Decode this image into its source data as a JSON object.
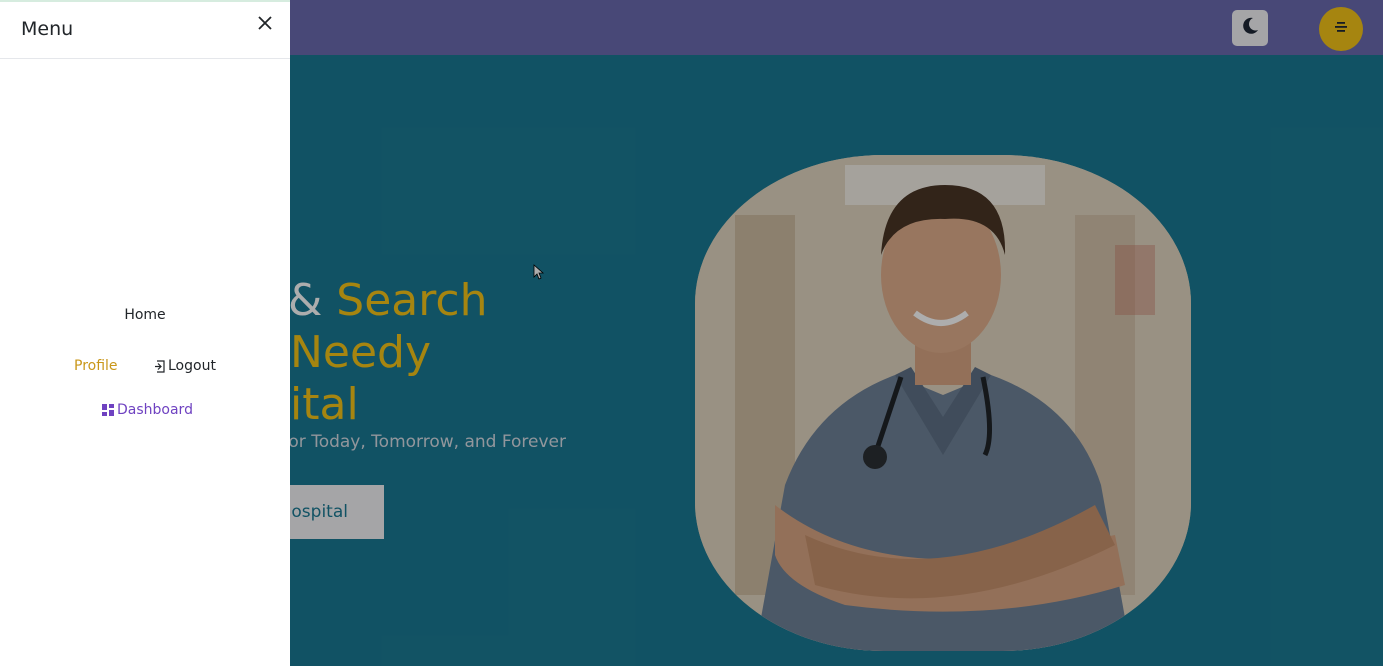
{
  "drawer": {
    "title": "Menu",
    "close_icon": "close-icon",
    "nav": {
      "home": "Home",
      "profile": "Profile",
      "logout": "Logout",
      "dashboard": "Dashboard"
    }
  },
  "header": {
    "theme_toggle_icon": "moon-icon",
    "menu_icon": "menu-lines-icon"
  },
  "hero": {
    "title_part_white": "& ",
    "title_part_1": "Search",
    "title_line_2": "Needy",
    "title_line_3": "ital",
    "subtitle": "or Today, Tomorrow, and Forever",
    "button_label": "Hospital",
    "button_label_visible": "lospital"
  },
  "colors": {
    "navbar": "#6a6ab0",
    "hero_bg": "#1a7a94",
    "accent_yellow": "#f5c518",
    "profile_link": "#c9971a",
    "dashboard_link": "#6f42c1"
  }
}
